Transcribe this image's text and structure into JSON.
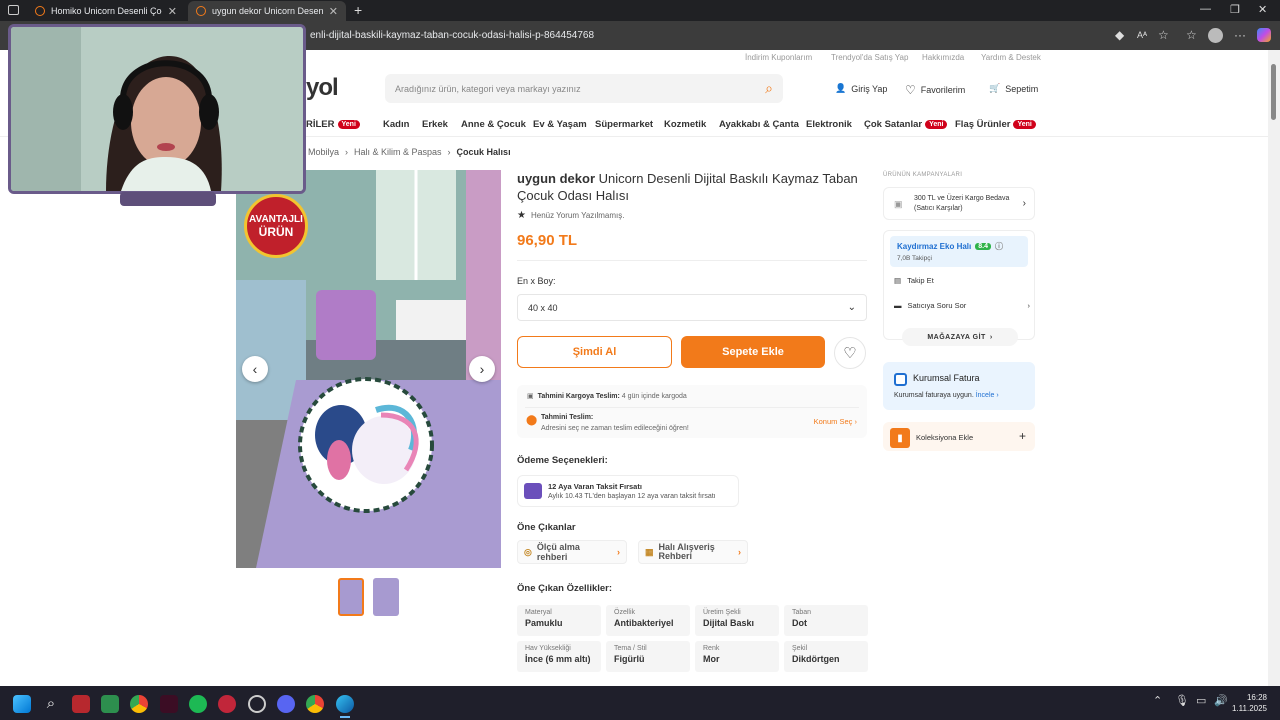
{
  "browser": {
    "tabs": [
      {
        "label": "Homiko Unicorn Desenli Çocuk ve"
      },
      {
        "label": "uygun dekor Unicorn Desenli Dij"
      }
    ],
    "url": "enli-dijital-baskili-kaymaz-taban-cocuk-odasi-halisi-p-864454768"
  },
  "header": {
    "top_links": [
      "İndirim Kuponlarım",
      "Trendyol'da Satış Yap",
      "Hakkımızda",
      "Yardım & Destek"
    ],
    "logo_fragment": "yol",
    "search_placeholder": "Aradığınız ürün, kategori veya markayı yazınız",
    "login": "Giriş Yap",
    "favorites": "Favorilerim",
    "cart": "Sepetim"
  },
  "nav": {
    "first_fragment": "RİLER",
    "items": [
      "Kadın",
      "Erkek",
      "Anne & Çocuk",
      "Ev & Yaşam",
      "Süpermarket",
      "Kozmetik",
      "Ayakkabı & Çanta",
      "Elektronik",
      "Çok Satanlar",
      "Flaş Ürünler"
    ],
    "new_badge": "Yeni"
  },
  "breadcrumb": [
    "Mobilya",
    "Halı & Kilim & Paspas",
    "Çocuk Halısı"
  ],
  "product": {
    "brand": "uygun dekor",
    "name": "Unicorn Desenli Dijital Baskılı Kaymaz Taban Çocuk Odası Halısı",
    "rating_text": "Henüz Yorum Yazılmamış.",
    "price": "96,90 TL",
    "badge_line1": "AVANTAJLI",
    "badge_line2": "ÜRÜN",
    "size_label": "En x Boy:",
    "size_value": "40 x 40",
    "buy_now": "Şimdi Al",
    "add_to_cart": "Sepete Ekle",
    "cargo_label": "Tahmini Kargoya Teslim:",
    "cargo_value": "4 gün içinde kargoda",
    "delivery_label": "Tahmini Teslim:",
    "delivery_value": "Adresini seç ne zaman teslim edileceğini öğren!",
    "location_select": "Konum Seç",
    "payment_title": "Ödeme Seçenekleri:",
    "installment_title": "12 Aya Varan Taksit Fırsatı",
    "installment_desc": "Aylık 10.43 TL'den başlayan 12 aya varan taksit fırsatı",
    "highlights_title": "Öne Çıkanlar",
    "highlight1": "Ölçü alma rehberi",
    "highlight2a": "Halı Alışveriş",
    "highlight2b": "Rehberi",
    "features_title": "Öne Çıkan Özellikler:",
    "attributes": [
      {
        "k": "Materyal",
        "v": "Pamuklu"
      },
      {
        "k": "Özellik",
        "v": "Antibakteriyel"
      },
      {
        "k": "Üretim Şekli",
        "v": "Dijital Baskı"
      },
      {
        "k": "Taban",
        "v": "Dot"
      },
      {
        "k": "Hav Yüksekliği",
        "v": "İnce (6 mm altı)"
      },
      {
        "k": "Tema / Stil",
        "v": "Figürlü"
      },
      {
        "k": "Renk",
        "v": "Mor"
      },
      {
        "k": "Şekil",
        "v": "Dikdörtgen"
      }
    ]
  },
  "sidebar": {
    "campaign_title": "ÜRÜNÜN KAMPANYALARI",
    "campaign_line1": "300 TL ve Üzeri Kargo Bedava",
    "campaign_line2": "(Satıcı Karşılar)",
    "seller_name": "Kaydırmaz Eko Halı",
    "seller_score": "8.4",
    "followers": "7,0B Takipçi",
    "follow": "Takip Et",
    "ask_seller": "Satıcıya Soru Sor",
    "go_store": "MAĞAZAYA GİT",
    "invoice_title": "Kurumsal Fatura",
    "invoice_desc": "Kurumsal faturaya uygun.",
    "invoice_link": "İncele",
    "collection": "Koleksiyona Ekle"
  },
  "taskbar": {
    "time": "16:28",
    "date": "1.11.2025"
  },
  "colors": {
    "accent": "#f27a1a",
    "new_badge": "#d0021b",
    "seller_bg": "#e8f3fd",
    "invoice_bg": "#eaf4fe"
  }
}
